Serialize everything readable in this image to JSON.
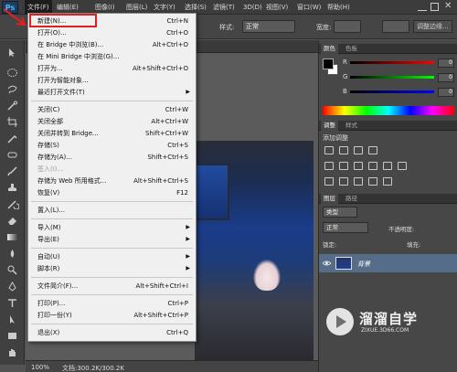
{
  "menubar": {
    "logo": "Ps",
    "items": [
      "文件(F)",
      "编辑(E)",
      "图像(I)",
      "图层(L)",
      "文字(Y)",
      "选择(S)",
      "滤镜(T)",
      "3D(D)",
      "视图(V)",
      "窗口(W)",
      "帮助(H)"
    ]
  },
  "options": {
    "style_label": "样式:",
    "style_value": "正常",
    "width_label": "宽度:",
    "adjust_edge": "调整边缘..."
  },
  "file_menu": [
    {
      "label": "新建(N)...",
      "shortcut": "Ctrl+N"
    },
    {
      "label": "打开(O)...",
      "shortcut": "Ctrl+O"
    },
    {
      "label": "在 Bridge 中浏览(B)...",
      "shortcut": "Alt+Ctrl+O"
    },
    {
      "label": "在 Mini Bridge 中浏览(G)...",
      "shortcut": ""
    },
    {
      "label": "打开为...",
      "shortcut": "Alt+Shift+Ctrl+O"
    },
    {
      "label": "打开为智能对象...",
      "shortcut": ""
    },
    {
      "label": "最近打开文件(T)",
      "shortcut": ""
    },
    {
      "label": "关闭(C)",
      "shortcut": "Ctrl+W"
    },
    {
      "label": "关闭全部",
      "shortcut": "Alt+Ctrl+W"
    },
    {
      "label": "关闭并转到 Bridge...",
      "shortcut": "Shift+Ctrl+W"
    },
    {
      "label": "存储(S)",
      "shortcut": "Ctrl+S"
    },
    {
      "label": "存储为(A)...",
      "shortcut": "Shift+Ctrl+S"
    },
    {
      "label": "签入(I)...",
      "shortcut": ""
    },
    {
      "label": "存储为 Web 所用格式...",
      "shortcut": "Alt+Shift+Ctrl+S"
    },
    {
      "label": "恢复(V)",
      "shortcut": "F12"
    },
    {
      "label": "置入(L)...",
      "shortcut": ""
    },
    {
      "label": "导入(M)",
      "shortcut": ""
    },
    {
      "label": "导出(E)",
      "shortcut": ""
    },
    {
      "label": "自动(U)",
      "shortcut": ""
    },
    {
      "label": "脚本(R)",
      "shortcut": ""
    },
    {
      "label": "文件简介(F)...",
      "shortcut": "Alt+Shift+Ctrl+I"
    },
    {
      "label": "打印(P)...",
      "shortcut": "Ctrl+P"
    },
    {
      "label": "打印一份(Y)",
      "shortcut": "Alt+Shift+Ctrl+P"
    },
    {
      "label": "退出(X)",
      "shortcut": "Ctrl+Q"
    }
  ],
  "color_panel": {
    "tabs": [
      "颜色",
      "色板"
    ],
    "r_label": "R",
    "r_value": "0",
    "g_label": "G",
    "g_value": "0",
    "b_label": "B",
    "b_value": "0"
  },
  "adjust_panel": {
    "tabs": [
      "调整",
      "样式"
    ],
    "title": "添加调整"
  },
  "layers_panel": {
    "tabs": [
      "图层",
      "路径"
    ],
    "kind": "类型",
    "blend": "正常",
    "opacity_label": "不透明度:",
    "lock_label": "锁定:",
    "fill_label": "填充:",
    "layer_name": "背景"
  },
  "status": {
    "zoom": "100%",
    "doc": "文档:300.2K/300.2K"
  },
  "watermark": {
    "title": "溜溜自学",
    "url": "ZIXUE.3D66.COM"
  },
  "colors": {
    "highlight": "#e02020",
    "layer_selected": "#566d8a"
  }
}
